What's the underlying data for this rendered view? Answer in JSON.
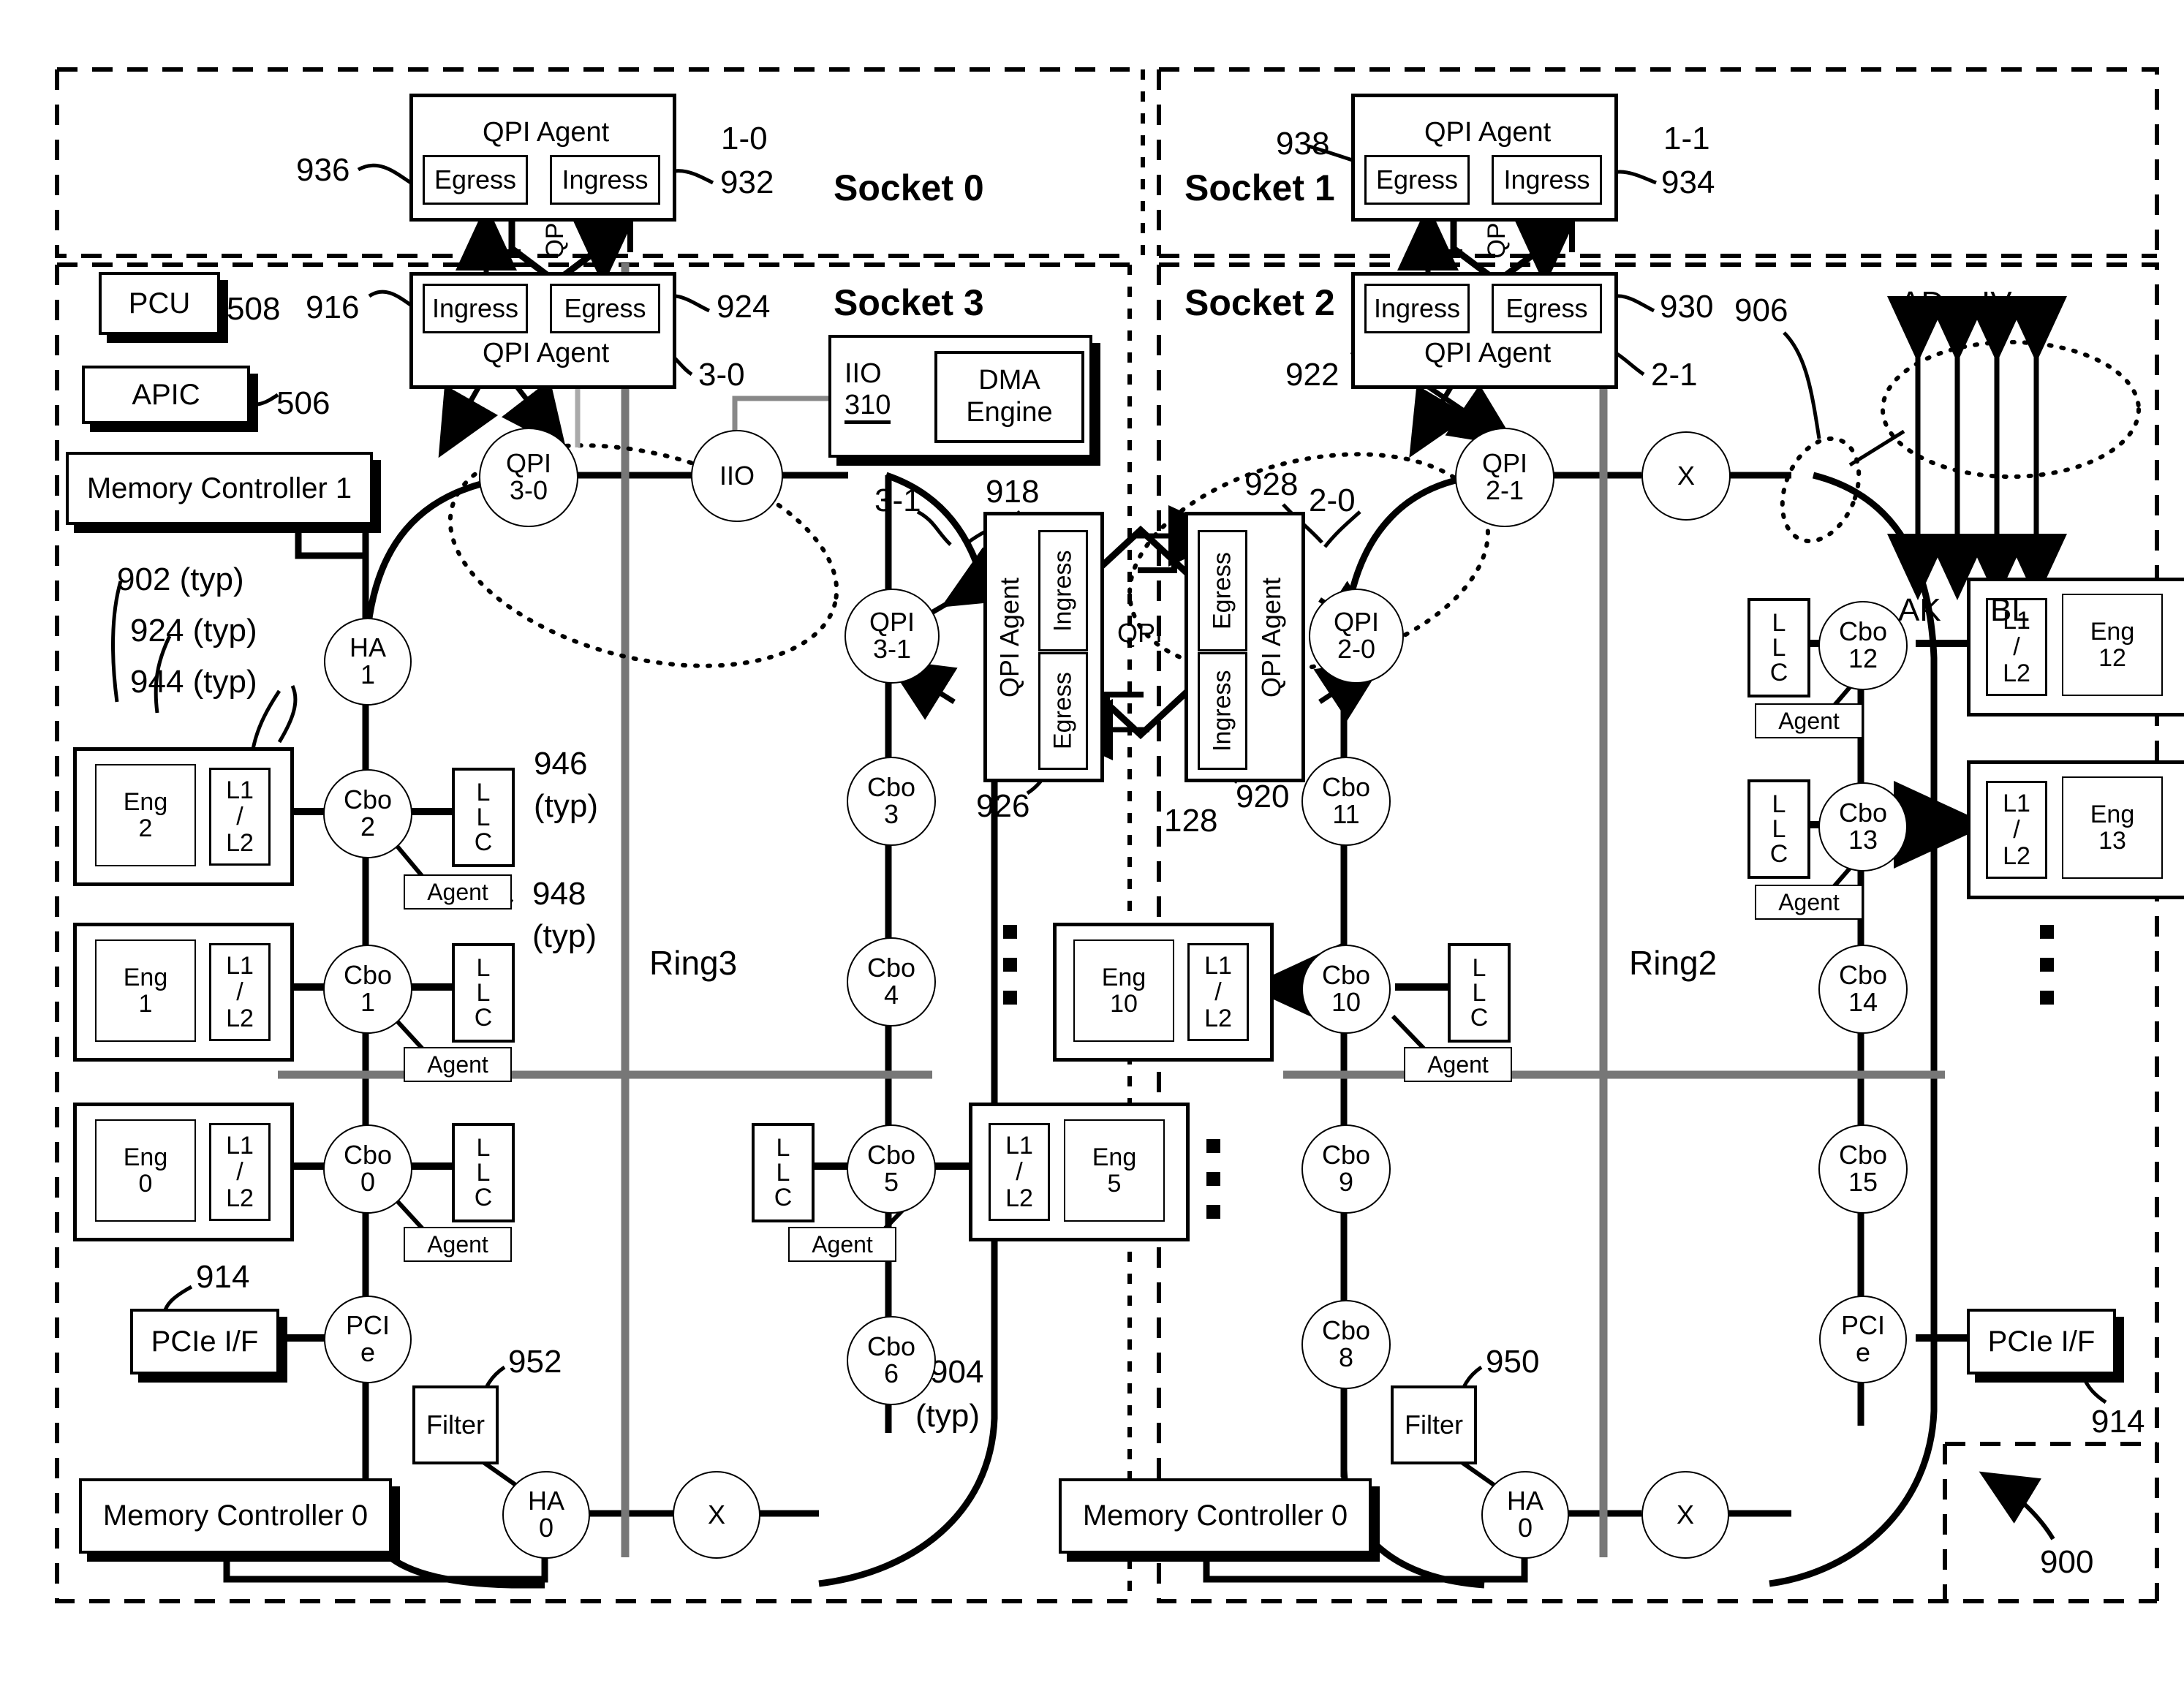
{
  "figure": {
    "id": "900",
    "sockets": [
      {
        "name": "Socket 0"
      },
      {
        "name": "Socket 1"
      },
      {
        "name": "Socket 3"
      },
      {
        "name": "Socket 2"
      }
    ]
  },
  "labels": {
    "qpi_agent": "QPI Agent",
    "egress": "Egress",
    "ingress": "Ingress",
    "qpi": "QPI",
    "agent": "Agent",
    "llc": "L\nL\nC",
    "llc_l": "L",
    "llc_c": "C",
    "l1": "L1",
    "slash": "/",
    "l2": "L2",
    "filter": "Filter",
    "pcie_if": "PCIe I/F",
    "pcie_node_a": "PCI",
    "pcie_node_b": "e",
    "pcu": "PCU",
    "apic": "APIC",
    "mc1": "Memory Controller 1",
    "mc0": "Memory Controller 0",
    "iio": "IIO",
    "iio_num": "310",
    "dma": "DMA",
    "dma2": "Engine",
    "ring3": "Ring3",
    "ring2": "Ring2",
    "x": "X",
    "ha": "HA",
    "cbo": "Cbo",
    "eng": "Eng"
  },
  "refnums": {
    "n1_0": "1-0",
    "n1_1": "1-1",
    "n3_0": "3-0",
    "n2_1": "2-1",
    "n3_1": "3-1",
    "n2_0": "2-0",
    "r936": "936",
    "r932": "932",
    "r938": "938",
    "r934": "934",
    "r508": "508",
    "r916": "916",
    "r924": "924",
    "r930": "930",
    "r922": "922",
    "r906": "906",
    "r918": "918",
    "r928": "928",
    "r926": "926",
    "r920": "920",
    "r128": "128",
    "r902typ": "902 (typ)",
    "r924typ": "924 (typ)",
    "r944typ": "944 (typ)",
    "r946typ_a": "946",
    "r946typ_b": "(typ)",
    "r948typ_a": "948",
    "r948typ_b": "(typ)",
    "r904typ_a": "904",
    "r904typ_b": "(typ)",
    "r914_left": "914",
    "r914_right": "914",
    "r952": "952",
    "r950": "950",
    "r506": "506",
    "r900": "900"
  },
  "ring_signals": {
    "ad": "AD",
    "iv": "IV",
    "ak": "AK",
    "bl": "BL"
  },
  "ring3": {
    "name": "Ring3",
    "nodes": [
      {
        "type": "qpi",
        "line1": "QPI",
        "line2": "3-0"
      },
      {
        "type": "iio",
        "line1": "IIO",
        "line2": ""
      },
      {
        "type": "ha",
        "line1": "HA",
        "line2": "1"
      },
      {
        "type": "cbo",
        "line1": "Cbo",
        "line2": "2"
      },
      {
        "type": "cbo",
        "line1": "Cbo",
        "line2": "1"
      },
      {
        "type": "cbo",
        "line1": "Cbo",
        "line2": "0"
      },
      {
        "type": "pcie",
        "line1": "PCI",
        "line2": "e"
      },
      {
        "type": "ha",
        "line1": "HA",
        "line2": "0"
      },
      {
        "type": "x",
        "line1": "X",
        "line2": ""
      },
      {
        "type": "cbo",
        "line1": "Cbo",
        "line2": "6"
      },
      {
        "type": "cbo",
        "line1": "Cbo",
        "line2": "5"
      },
      {
        "type": "cbo",
        "line1": "Cbo",
        "line2": "4"
      },
      {
        "type": "cbo",
        "line1": "Cbo",
        "line2": "3"
      },
      {
        "type": "qpi",
        "line1": "QPI",
        "line2": "3-1"
      }
    ],
    "cores": [
      {
        "eng": "Eng",
        "num": "2"
      },
      {
        "eng": "Eng",
        "num": "1"
      },
      {
        "eng": "Eng",
        "num": "0"
      },
      {
        "eng": "Eng",
        "num": "5"
      }
    ]
  },
  "ring2": {
    "name": "Ring2",
    "nodes": [
      {
        "type": "qpi",
        "line1": "QPI",
        "line2": "2-1"
      },
      {
        "type": "x",
        "line1": "X",
        "line2": ""
      },
      {
        "type": "qpi",
        "line1": "QPI",
        "line2": "2-0"
      },
      {
        "type": "cbo",
        "line1": "Cbo",
        "line2": "11"
      },
      {
        "type": "cbo",
        "line1": "Cbo",
        "line2": "10"
      },
      {
        "type": "cbo",
        "line1": "Cbo",
        "line2": "9"
      },
      {
        "type": "cbo",
        "line1": "Cbo",
        "line2": "8"
      },
      {
        "type": "ha",
        "line1": "HA",
        "line2": "0"
      },
      {
        "type": "x",
        "line1": "X",
        "line2": ""
      },
      {
        "type": "pcie",
        "line1": "PCI",
        "line2": "e"
      },
      {
        "type": "cbo",
        "line1": "Cbo",
        "line2": "15"
      },
      {
        "type": "cbo",
        "line1": "Cbo",
        "line2": "14"
      },
      {
        "type": "cbo",
        "line1": "Cbo",
        "line2": "13"
      },
      {
        "type": "cbo",
        "line1": "Cbo",
        "line2": "12"
      }
    ],
    "cores": [
      {
        "eng": "Eng",
        "num": "10"
      },
      {
        "eng": "Eng",
        "num": "12"
      },
      {
        "eng": "Eng",
        "num": "13"
      }
    ]
  }
}
